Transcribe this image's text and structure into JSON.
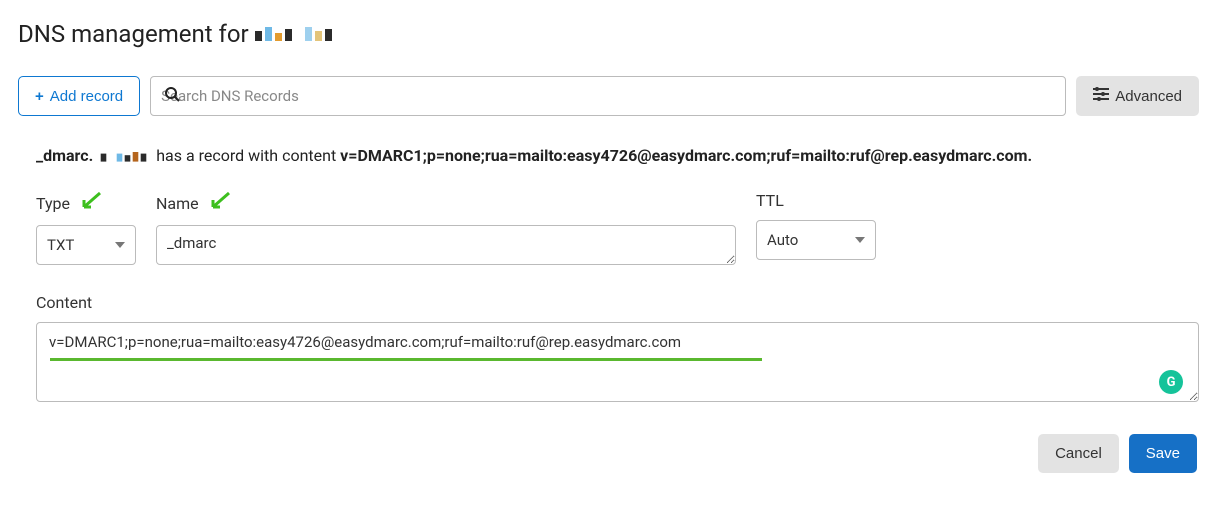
{
  "header": {
    "title_prefix": "DNS management for"
  },
  "toolbar": {
    "add_label": "Add record",
    "search_placeholder": "Search DNS Records",
    "advanced_label": "Advanced"
  },
  "notice": {
    "domain_prefix": "_dmarc.",
    "has_record_text": "has a record with content",
    "record_content": "v=DMARC1;p=none;rua=mailto:easy4726@easydmarc.com;ruf=mailto:ruf@rep.easydmarc.com",
    "trailing_dot": "."
  },
  "fields": {
    "type": {
      "label": "Type",
      "value": "TXT"
    },
    "name": {
      "label": "Name",
      "value": "_dmarc"
    },
    "ttl": {
      "label": "TTL",
      "value": "Auto"
    },
    "content": {
      "label": "Content",
      "value": "v=DMARC1;p=none;rua=mailto:easy4726@easydmarc.com;ruf=mailto:ruf@rep.easydmarc.com"
    }
  },
  "actions": {
    "cancel": "Cancel",
    "save": "Save"
  },
  "icons": {
    "plus": "+",
    "grammarly": "G"
  },
  "colors": {
    "accent_blue": "#0e78d1",
    "save_blue": "#1670c6",
    "hint_green": "#3dbf1e",
    "grammarly": "#15c39a"
  }
}
